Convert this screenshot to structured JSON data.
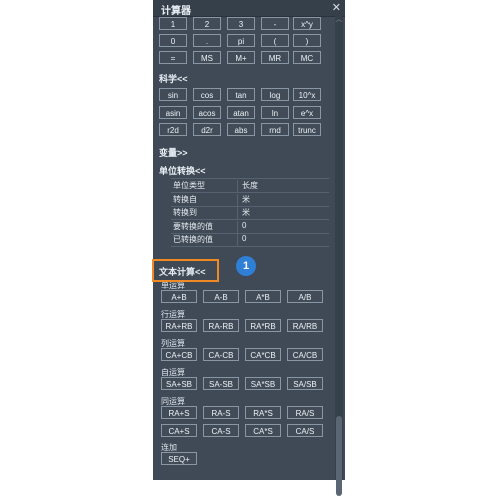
{
  "titlebar": {
    "title": "计算器",
    "close_glyph": "✕"
  },
  "basic": {
    "row1": [
      "1",
      "2",
      "3",
      "-",
      "x^y"
    ],
    "row2": [
      "0",
      ".",
      "pi",
      "(",
      ")"
    ],
    "row3": [
      "=",
      "MS",
      "M+",
      "MR",
      "MC"
    ]
  },
  "science": {
    "title": "科学<<",
    "row1": [
      "sin",
      "cos",
      "tan",
      "log",
      "10^x"
    ],
    "row2": [
      "asin",
      "acos",
      "atan",
      "ln",
      "e^x"
    ],
    "row3": [
      "r2d",
      "d2r",
      "abs",
      "rnd",
      "trunc"
    ]
  },
  "variables": {
    "title": "变量>>"
  },
  "unit_conversion": {
    "title": "单位转换<<",
    "rows": [
      {
        "key": "单位类型",
        "value": "长度"
      },
      {
        "key": "转换自",
        "value": "米"
      },
      {
        "key": "转换到",
        "value": "米"
      },
      {
        "key": "要转换的值",
        "value": "0"
      },
      {
        "key": "已转换的值",
        "value": "0"
      }
    ]
  },
  "text_calc": {
    "title": "文本计算<<",
    "groups": [
      {
        "label": "单运算",
        "rows": [
          [
            "A+B",
            "A-B",
            "A*B",
            "A/B"
          ]
        ]
      },
      {
        "label": "行运算",
        "rows": [
          [
            "RA+RB",
            "RA-RB",
            "RA*RB",
            "RA/RB"
          ]
        ]
      },
      {
        "label": "列运算",
        "rows": [
          [
            "CA+CB",
            "CA-CB",
            "CA*CB",
            "CA/CB"
          ]
        ]
      },
      {
        "label": "自运算",
        "rows": [
          [
            "SA+SB",
            "SA-SB",
            "SA*SB",
            "SA/SB"
          ]
        ]
      },
      {
        "label": "同运算",
        "rows": [
          [
            "RA+S",
            "RA-S",
            "RA*S",
            "RA/S"
          ],
          [
            "CA+S",
            "CA-S",
            "CA*S",
            "CA/S"
          ]
        ]
      },
      {
        "label": "连加",
        "rows": [
          [
            "SEQ+"
          ]
        ]
      }
    ]
  },
  "callout": {
    "badge": "1",
    "highlight_color": "#f08a24",
    "badge_color": "#2f7fd6"
  },
  "colors": {
    "panel": "#3f4a56",
    "titlebar": "#36404b",
    "button_border": "#8a96a2"
  }
}
